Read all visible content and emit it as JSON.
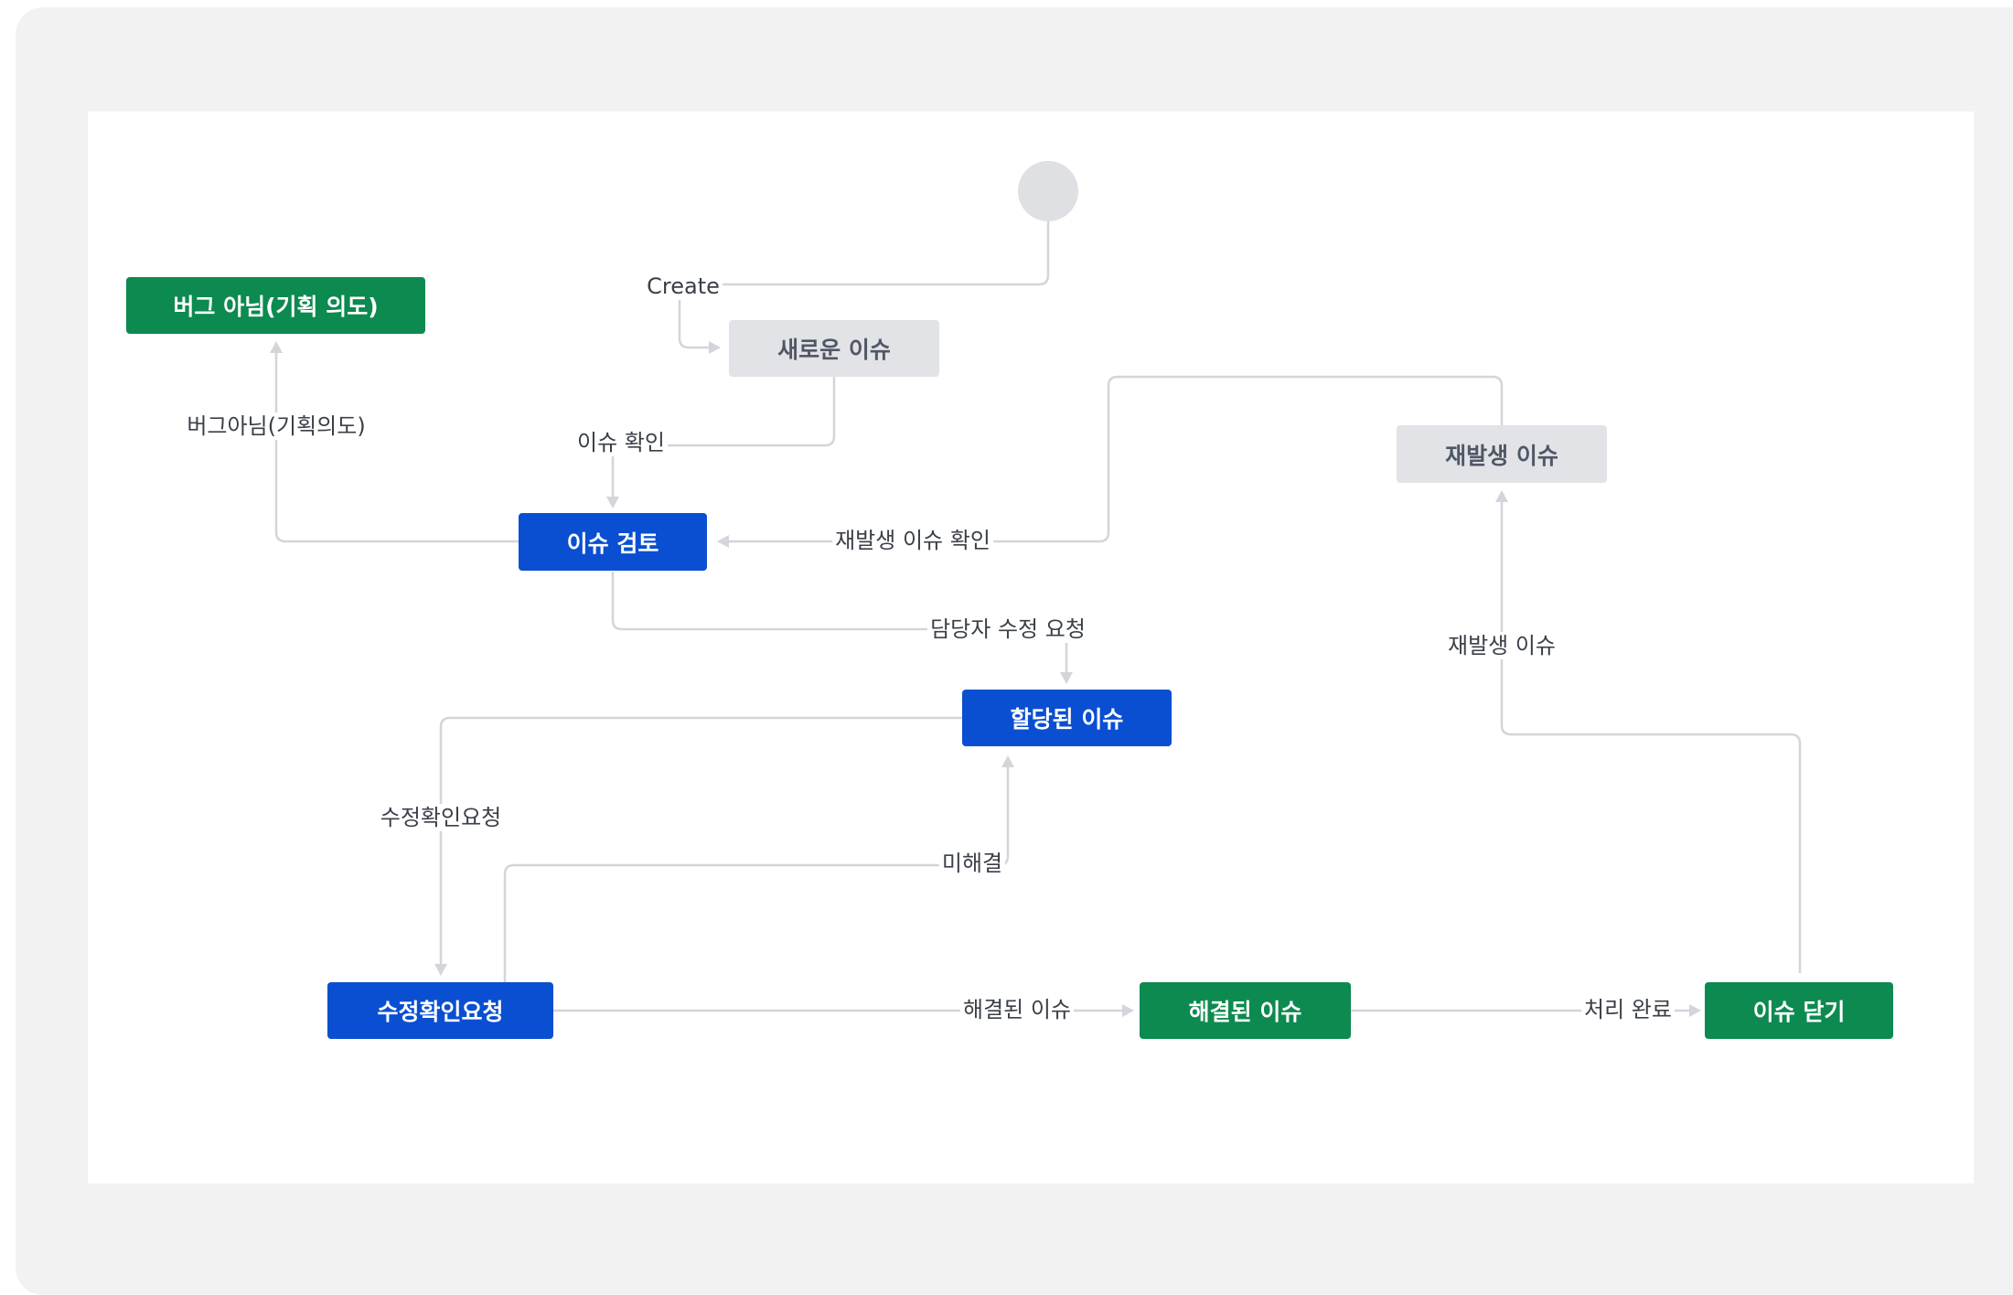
{
  "nodes": {
    "not_bug": "버그 아님(기획 의도)",
    "new_issue": "새로운 이슈",
    "reopened": "재발생 이슈",
    "review": "이슈 검토",
    "assigned": "할당된 이슈",
    "verify": "수정확인요청",
    "resolved": "해결된 이슈",
    "closed": "이슈 닫기"
  },
  "transitions": {
    "create": "Create",
    "not_bug": "버그아님(기획의도)",
    "confirm": "이슈 확인",
    "reopen_confirm": "재발생 이슈 확인",
    "request_fix": "담당자 수정 요청",
    "request_verify": "수정확인요청",
    "unresolved": "미해결",
    "resolved": "해결된 이슈",
    "reopen": "재발생 이슈",
    "done": "처리 완료"
  },
  "colors": {
    "done_status": "#0c8a50",
    "in_progress_status": "#0a4fd1",
    "todo_status": "#e2e3e6",
    "connector": "#d3d5da"
  }
}
